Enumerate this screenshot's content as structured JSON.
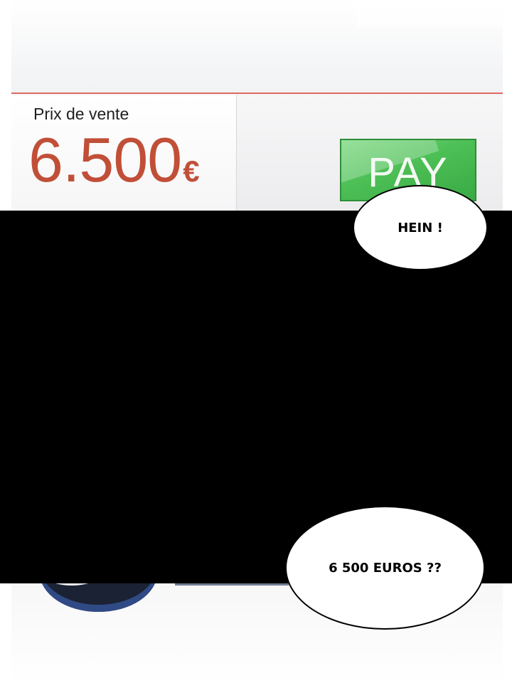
{
  "price_panel": {
    "label": "Prix de vente",
    "amount": "6.500",
    "currency": "€",
    "price_color": "#c14f38"
  },
  "pay_button": {
    "label": "PAY",
    "color": "#4cbf55"
  },
  "bubbles": [
    {
      "text": "HEIN !"
    },
    {
      "text": "6 500 EUROS ??"
    }
  ]
}
